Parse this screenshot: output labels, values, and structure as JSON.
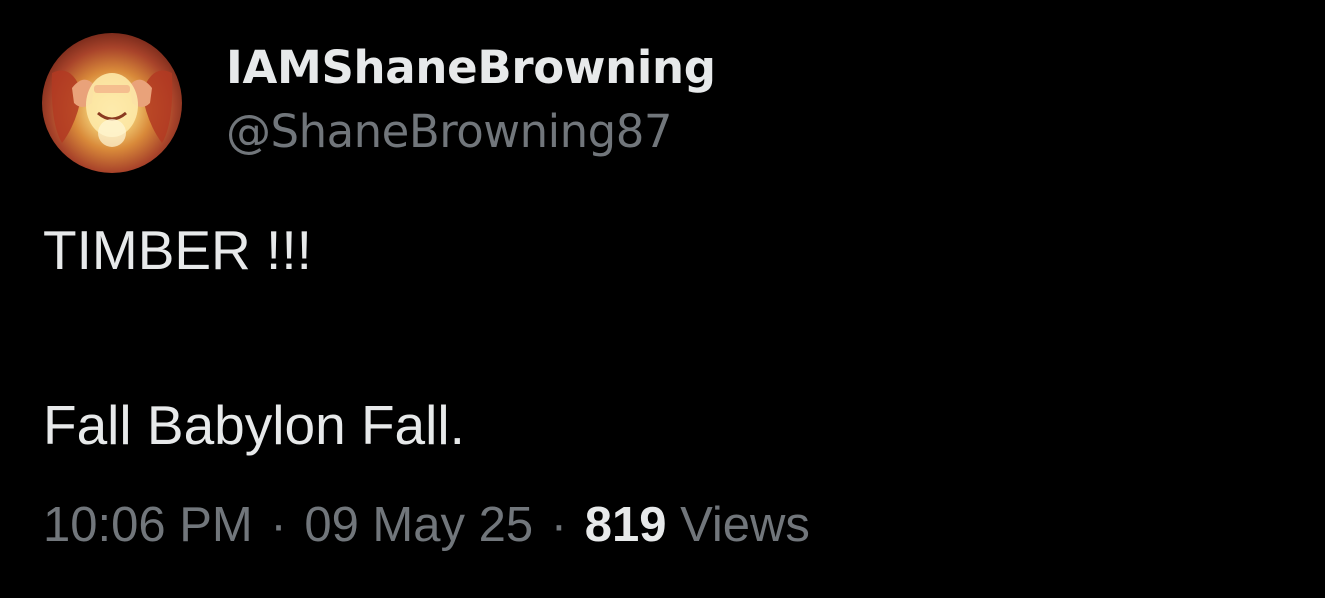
{
  "user": {
    "display_name": "IAMShaneBrowning",
    "handle": "@ShaneBrowning87",
    "avatar_icon": "profile-avatar"
  },
  "tweet": {
    "lines": [
      "TIMBER !!!",
      "Fall Babylon Fall."
    ],
    "time": "10:06 PM",
    "separator": "·",
    "date": "09 May 25",
    "views_count": "819",
    "views_label": "Views"
  },
  "colors": {
    "background": "#000000",
    "primary_text": "#e7e9ea",
    "secondary_text": "#71767b"
  }
}
